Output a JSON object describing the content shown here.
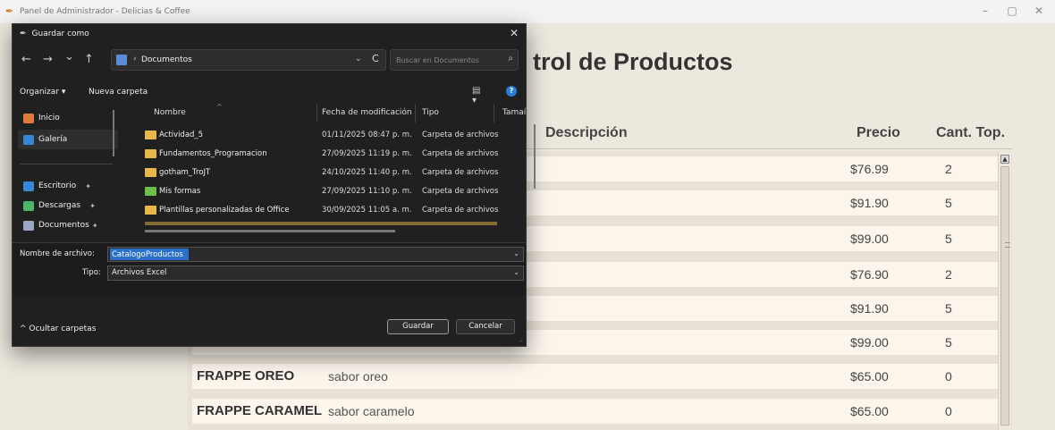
{
  "app": {
    "window_title": "Panel de Administrador - Delicias & Coffee",
    "minimize": "–",
    "maximize": "▢",
    "close": "✕",
    "page_title": "trol de Productos",
    "columns": {
      "description": "Descripción",
      "price": "Precio",
      "qty": "Cant. Top."
    },
    "rows": [
      {
        "name": "",
        "description": "",
        "price": "$76.99",
        "qty": "2"
      },
      {
        "name": "",
        "description": "",
        "price": "$91.90",
        "qty": "5"
      },
      {
        "name": "",
        "description": "",
        "price": "$99.00",
        "qty": "5"
      },
      {
        "name": "",
        "description": "",
        "price": "$76.90",
        "qty": "2"
      },
      {
        "name": "",
        "description": "",
        "price": "$91.90",
        "qty": "5"
      },
      {
        "name": "",
        "description": "",
        "price": "$99.00",
        "qty": "5"
      },
      {
        "name": "FRAPPE OREO",
        "description": "sabor oreo",
        "price": "$65.00",
        "qty": "0"
      },
      {
        "name": "FRAPPE CARAMEL(",
        "description": "sabor caramelo",
        "price": "$65.00",
        "qty": "0"
      }
    ]
  },
  "dialog": {
    "title": "Guardar como",
    "close": "✕",
    "nav": {
      "back": "←",
      "forward": "→",
      "recent": "⌄",
      "up": "↑"
    },
    "address": {
      "separator": "›",
      "path": "Documentos",
      "dropdown": "⌄",
      "refresh": "C"
    },
    "search_placeholder": "Buscar en Documentos",
    "toolbar": {
      "organize": "Organizar ▾",
      "new_folder": "Nueva carpeta",
      "view": "▤ ▾",
      "help": "?"
    },
    "nav_pane": [
      {
        "label": "Inicio",
        "color": "#e07a3a"
      },
      {
        "label": "Galería",
        "color": "#3a86d6"
      },
      {
        "label": "Escritorio",
        "color": "#3a86d6"
      },
      {
        "label": "Descargas",
        "color": "#4ab86a"
      },
      {
        "label": "Documentos",
        "color": "#9aa7c0"
      }
    ],
    "pin": "📌",
    "file_columns": {
      "name": "Nombre",
      "date": "Fecha de modificación",
      "type": "Tipo",
      "size": "Tamaí"
    },
    "files": [
      {
        "name": "Actividad_5",
        "date": "01/11/2025 08:47 p. m.",
        "type": "Carpeta de archivos"
      },
      {
        "name": "Fundamentos_Programacion",
        "date": "27/09/2025 11:19 p. m.",
        "type": "Carpeta de archivos"
      },
      {
        "name": "gotham_TroJT",
        "date": "24/10/2025 11:40 p. m.",
        "type": "Carpeta de archivos"
      },
      {
        "name": "Mis formas",
        "date": "27/09/2025 11:10 p. m.",
        "type": "Carpeta de archivos"
      },
      {
        "name": "Plantillas personalizadas de Office",
        "date": "30/09/2025 11:05 a. m.",
        "type": "Carpeta de archivos"
      }
    ],
    "filename_label": "Nombre de archivo:",
    "filename_value": "CatalogoProductos",
    "type_label": "Tipo:",
    "type_value": "Archivos Excel",
    "hide_folders": "^ Ocultar carpetas",
    "save": "Guardar",
    "cancel": "Cancelar"
  }
}
